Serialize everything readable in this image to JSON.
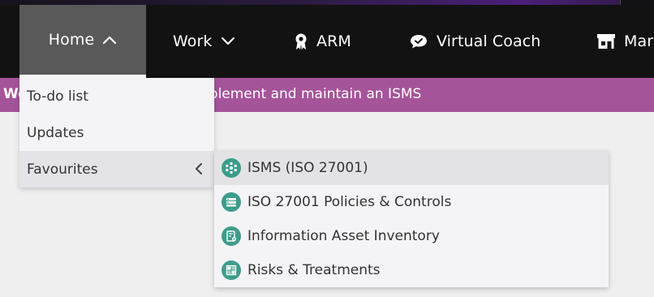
{
  "nav": {
    "home_label": "Home",
    "work_label": "Work",
    "arm_label": "ARM",
    "coach_label": "Virtual Coach",
    "mar_label": "Mar"
  },
  "banner": {
    "left_text": "We",
    "text": "nplement and maintain an ISMS"
  },
  "home_menu": {
    "items": [
      {
        "label": "To-do list"
      },
      {
        "label": "Updates"
      },
      {
        "label": "Favourites"
      }
    ]
  },
  "favourites": {
    "items": [
      {
        "label": "ISMS (ISO 27001)",
        "icon": "isms-icon"
      },
      {
        "label": "ISO 27001 Policies & Controls",
        "icon": "policies-icon"
      },
      {
        "label": "Information Asset Inventory",
        "icon": "asset-inventory-icon"
      },
      {
        "label": "Risks & Treatments",
        "icon": "risks-icon"
      }
    ]
  },
  "colors": {
    "navbar": "#121212",
    "nav_active": "#595959",
    "banner": "#a5549a",
    "icon_teal": "#3d9c8a"
  }
}
